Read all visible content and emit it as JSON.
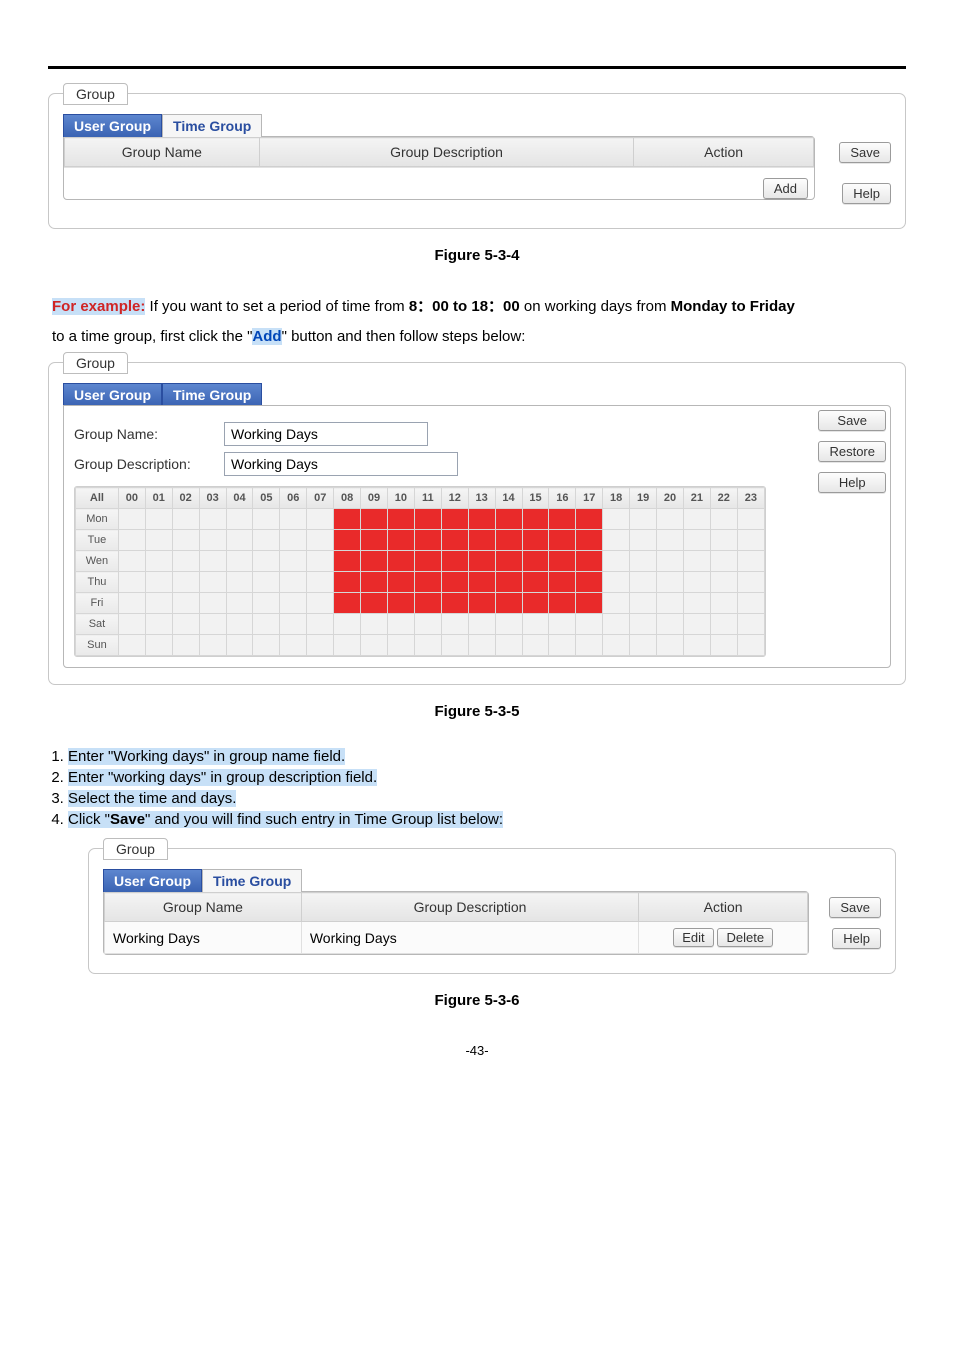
{
  "pageNumber": "-43-",
  "figure1": {
    "tabLabel": "Group",
    "tabs": {
      "userGroup": "User Group",
      "timeGroup": "Time Group"
    },
    "headers": {
      "name": "Group Name",
      "desc": "Group Description",
      "action": "Action"
    },
    "buttons": {
      "save": "Save",
      "help": "Help",
      "add": "Add"
    },
    "caption": "Figure 5-3-4"
  },
  "paragraph1": {
    "forExample": "For example:",
    "text1": " If you want to set a period of time from ",
    "timeFrom": "8：00 to 18：00",
    "text2": " on working days from ",
    "daysRange": "Monday to Friday",
    "text3": "to a time group, first click the \"",
    "addWord": "Add",
    "text4": "\" button and then follow steps below:"
  },
  "figure2": {
    "tabLabel": "Group",
    "tabs": {
      "userGroup": "User Group",
      "timeGroup": "Time Group"
    },
    "labels": {
      "groupName": "Group Name:",
      "groupDesc": "Group Description:"
    },
    "values": {
      "groupName": "Working Days",
      "groupDesc": "Working Days"
    },
    "buttons": {
      "save": "Save",
      "restore": "Restore",
      "help": "Help"
    },
    "hours": [
      "00",
      "01",
      "02",
      "03",
      "04",
      "05",
      "06",
      "07",
      "08",
      "09",
      "10",
      "11",
      "12",
      "13",
      "14",
      "15",
      "16",
      "17",
      "18",
      "19",
      "20",
      "21",
      "22",
      "23"
    ],
    "allLabel": "All",
    "days": [
      "Mon",
      "Tue",
      "Wen",
      "Thu",
      "Fri",
      "Sat",
      "Sun"
    ],
    "selection": {
      "rows": [
        "Mon",
        "Tue",
        "Wen",
        "Thu",
        "Fri"
      ],
      "startHour": 8,
      "endHour": 17
    },
    "caption": "Figure 5-3-5"
  },
  "steps": {
    "s1": "Enter \"Working days\" in group name field.",
    "s2": "Enter \"working days\" in group description field.",
    "s3": "Select the time and days.",
    "s4a": "Click \"",
    "s4save": "Save",
    "s4b": "\" and you will find such entry in Time Group list below:"
  },
  "figure3": {
    "tabLabel": "Group",
    "tabs": {
      "userGroup": "User Group",
      "timeGroup": "Time Group"
    },
    "headers": {
      "name": "Group Name",
      "desc": "Group Description",
      "action": "Action"
    },
    "row": {
      "name": "Working Days",
      "desc": "Working Days"
    },
    "buttons": {
      "save": "Save",
      "help": "Help",
      "edit": "Edit",
      "delete": "Delete"
    },
    "caption": "Figure 5-3-6"
  }
}
